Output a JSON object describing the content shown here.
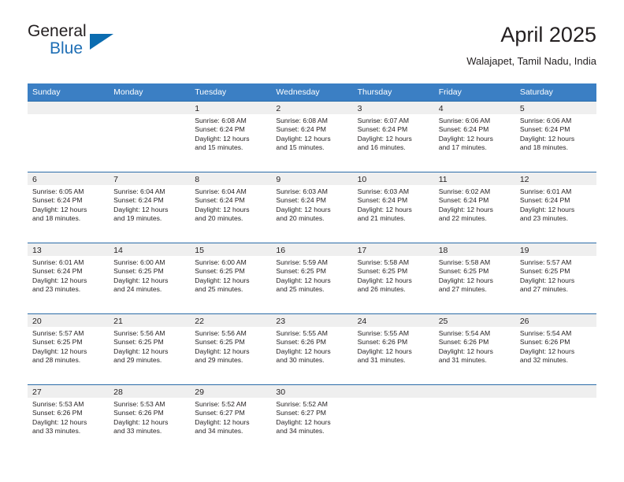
{
  "logo": {
    "word_top": "General",
    "word_bottom": "Blue",
    "triangle_color": "#0b6cb0",
    "blue_color": "#1f6fb5"
  },
  "header": {
    "title": "April 2025",
    "subtitle": "Walajapet, Tamil Nadu, India"
  },
  "theme": {
    "header_blue": "#3b7fc4",
    "rule_blue": "#2b6ca8",
    "band_gray": "#efefef"
  },
  "weekday_headers": [
    "Sunday",
    "Monday",
    "Tuesday",
    "Wednesday",
    "Thursday",
    "Friday",
    "Saturday"
  ],
  "weeks": [
    [
      {
        "day": "",
        "sunrise": "",
        "sunset": "",
        "daylight_1": "",
        "daylight_2": ""
      },
      {
        "day": "",
        "sunrise": "",
        "sunset": "",
        "daylight_1": "",
        "daylight_2": ""
      },
      {
        "day": "1",
        "sunrise": "Sunrise: 6:08 AM",
        "sunset": "Sunset: 6:24 PM",
        "daylight_1": "Daylight: 12 hours",
        "daylight_2": "and 15 minutes."
      },
      {
        "day": "2",
        "sunrise": "Sunrise: 6:08 AM",
        "sunset": "Sunset: 6:24 PM",
        "daylight_1": "Daylight: 12 hours",
        "daylight_2": "and 15 minutes."
      },
      {
        "day": "3",
        "sunrise": "Sunrise: 6:07 AM",
        "sunset": "Sunset: 6:24 PM",
        "daylight_1": "Daylight: 12 hours",
        "daylight_2": "and 16 minutes."
      },
      {
        "day": "4",
        "sunrise": "Sunrise: 6:06 AM",
        "sunset": "Sunset: 6:24 PM",
        "daylight_1": "Daylight: 12 hours",
        "daylight_2": "and 17 minutes."
      },
      {
        "day": "5",
        "sunrise": "Sunrise: 6:06 AM",
        "sunset": "Sunset: 6:24 PM",
        "daylight_1": "Daylight: 12 hours",
        "daylight_2": "and 18 minutes."
      }
    ],
    [
      {
        "day": "6",
        "sunrise": "Sunrise: 6:05 AM",
        "sunset": "Sunset: 6:24 PM",
        "daylight_1": "Daylight: 12 hours",
        "daylight_2": "and 18 minutes."
      },
      {
        "day": "7",
        "sunrise": "Sunrise: 6:04 AM",
        "sunset": "Sunset: 6:24 PM",
        "daylight_1": "Daylight: 12 hours",
        "daylight_2": "and 19 minutes."
      },
      {
        "day": "8",
        "sunrise": "Sunrise: 6:04 AM",
        "sunset": "Sunset: 6:24 PM",
        "daylight_1": "Daylight: 12 hours",
        "daylight_2": "and 20 minutes."
      },
      {
        "day": "9",
        "sunrise": "Sunrise: 6:03 AM",
        "sunset": "Sunset: 6:24 PM",
        "daylight_1": "Daylight: 12 hours",
        "daylight_2": "and 20 minutes."
      },
      {
        "day": "10",
        "sunrise": "Sunrise: 6:03 AM",
        "sunset": "Sunset: 6:24 PM",
        "daylight_1": "Daylight: 12 hours",
        "daylight_2": "and 21 minutes."
      },
      {
        "day": "11",
        "sunrise": "Sunrise: 6:02 AM",
        "sunset": "Sunset: 6:24 PM",
        "daylight_1": "Daylight: 12 hours",
        "daylight_2": "and 22 minutes."
      },
      {
        "day": "12",
        "sunrise": "Sunrise: 6:01 AM",
        "sunset": "Sunset: 6:24 PM",
        "daylight_1": "Daylight: 12 hours",
        "daylight_2": "and 23 minutes."
      }
    ],
    [
      {
        "day": "13",
        "sunrise": "Sunrise: 6:01 AM",
        "sunset": "Sunset: 6:24 PM",
        "daylight_1": "Daylight: 12 hours",
        "daylight_2": "and 23 minutes."
      },
      {
        "day": "14",
        "sunrise": "Sunrise: 6:00 AM",
        "sunset": "Sunset: 6:25 PM",
        "daylight_1": "Daylight: 12 hours",
        "daylight_2": "and 24 minutes."
      },
      {
        "day": "15",
        "sunrise": "Sunrise: 6:00 AM",
        "sunset": "Sunset: 6:25 PM",
        "daylight_1": "Daylight: 12 hours",
        "daylight_2": "and 25 minutes."
      },
      {
        "day": "16",
        "sunrise": "Sunrise: 5:59 AM",
        "sunset": "Sunset: 6:25 PM",
        "daylight_1": "Daylight: 12 hours",
        "daylight_2": "and 25 minutes."
      },
      {
        "day": "17",
        "sunrise": "Sunrise: 5:58 AM",
        "sunset": "Sunset: 6:25 PM",
        "daylight_1": "Daylight: 12 hours",
        "daylight_2": "and 26 minutes."
      },
      {
        "day": "18",
        "sunrise": "Sunrise: 5:58 AM",
        "sunset": "Sunset: 6:25 PM",
        "daylight_1": "Daylight: 12 hours",
        "daylight_2": "and 27 minutes."
      },
      {
        "day": "19",
        "sunrise": "Sunrise: 5:57 AM",
        "sunset": "Sunset: 6:25 PM",
        "daylight_1": "Daylight: 12 hours",
        "daylight_2": "and 27 minutes."
      }
    ],
    [
      {
        "day": "20",
        "sunrise": "Sunrise: 5:57 AM",
        "sunset": "Sunset: 6:25 PM",
        "daylight_1": "Daylight: 12 hours",
        "daylight_2": "and 28 minutes."
      },
      {
        "day": "21",
        "sunrise": "Sunrise: 5:56 AM",
        "sunset": "Sunset: 6:25 PM",
        "daylight_1": "Daylight: 12 hours",
        "daylight_2": "and 29 minutes."
      },
      {
        "day": "22",
        "sunrise": "Sunrise: 5:56 AM",
        "sunset": "Sunset: 6:25 PM",
        "daylight_1": "Daylight: 12 hours",
        "daylight_2": "and 29 minutes."
      },
      {
        "day": "23",
        "sunrise": "Sunrise: 5:55 AM",
        "sunset": "Sunset: 6:26 PM",
        "daylight_1": "Daylight: 12 hours",
        "daylight_2": "and 30 minutes."
      },
      {
        "day": "24",
        "sunrise": "Sunrise: 5:55 AM",
        "sunset": "Sunset: 6:26 PM",
        "daylight_1": "Daylight: 12 hours",
        "daylight_2": "and 31 minutes."
      },
      {
        "day": "25",
        "sunrise": "Sunrise: 5:54 AM",
        "sunset": "Sunset: 6:26 PM",
        "daylight_1": "Daylight: 12 hours",
        "daylight_2": "and 31 minutes."
      },
      {
        "day": "26",
        "sunrise": "Sunrise: 5:54 AM",
        "sunset": "Sunset: 6:26 PM",
        "daylight_1": "Daylight: 12 hours",
        "daylight_2": "and 32 minutes."
      }
    ],
    [
      {
        "day": "27",
        "sunrise": "Sunrise: 5:53 AM",
        "sunset": "Sunset: 6:26 PM",
        "daylight_1": "Daylight: 12 hours",
        "daylight_2": "and 33 minutes."
      },
      {
        "day": "28",
        "sunrise": "Sunrise: 5:53 AM",
        "sunset": "Sunset: 6:26 PM",
        "daylight_1": "Daylight: 12 hours",
        "daylight_2": "and 33 minutes."
      },
      {
        "day": "29",
        "sunrise": "Sunrise: 5:52 AM",
        "sunset": "Sunset: 6:27 PM",
        "daylight_1": "Daylight: 12 hours",
        "daylight_2": "and 34 minutes."
      },
      {
        "day": "30",
        "sunrise": "Sunrise: 5:52 AM",
        "sunset": "Sunset: 6:27 PM",
        "daylight_1": "Daylight: 12 hours",
        "daylight_2": "and 34 minutes."
      },
      {
        "day": "",
        "sunrise": "",
        "sunset": "",
        "daylight_1": "",
        "daylight_2": ""
      },
      {
        "day": "",
        "sunrise": "",
        "sunset": "",
        "daylight_1": "",
        "daylight_2": ""
      },
      {
        "day": "",
        "sunrise": "",
        "sunset": "",
        "daylight_1": "",
        "daylight_2": ""
      }
    ]
  ]
}
